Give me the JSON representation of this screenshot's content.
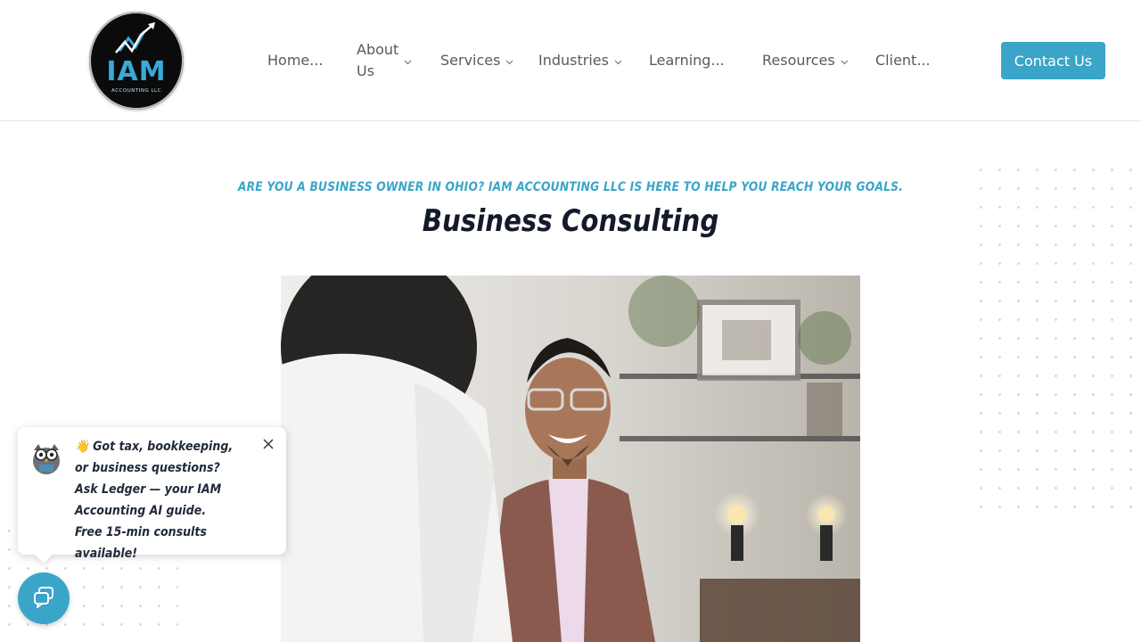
{
  "brand": {
    "logo_text": "IAM",
    "logo_subtext": "ACCOUNTING LLC",
    "colors": {
      "accent": "#3aa5c9",
      "title": "#141a2b",
      "nav": "#555b63"
    }
  },
  "nav": {
    "items": [
      {
        "label": "Home...",
        "has_dropdown": false
      },
      {
        "label_line1": "About",
        "label_line2": "Us",
        "has_dropdown": true
      },
      {
        "label": "Services",
        "has_dropdown": true
      },
      {
        "label": "Industries",
        "has_dropdown": true
      },
      {
        "label": "Learning...",
        "has_dropdown": false
      },
      {
        "label": "Resources",
        "has_dropdown": true
      },
      {
        "label": "Client...",
        "has_dropdown": false
      }
    ],
    "contact_label": "Contact Us"
  },
  "hero": {
    "eyebrow": "ARE YOU A BUSINESS OWNER IN OHIO? IAM ACCOUNTING LLC IS HERE TO HELP YOU REACH YOUR GOALS.",
    "title": "Business Consulting"
  },
  "chat": {
    "message": "👋 Got tax, bookkeeping, or business questions? Ask Ledger — your IAM Accounting AI guide. Free 15-min consults available!",
    "icons": {
      "avatar": "owl-avatar-icon",
      "close": "close-icon",
      "launcher": "chat-bubble-icon"
    }
  }
}
